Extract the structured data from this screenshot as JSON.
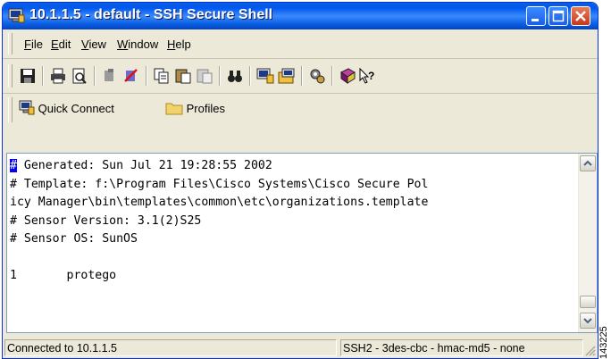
{
  "window": {
    "title": "10.1.1.5 - default - SSH Secure Shell",
    "title_color": "#ffffff",
    "titlebar_color": "#0058ee"
  },
  "menu": {
    "items": [
      {
        "label": "File",
        "u": "F",
        "rest": "ile"
      },
      {
        "label": "Edit",
        "u": "E",
        "rest": "dit"
      },
      {
        "label": "View",
        "u": "V",
        "rest": "iew"
      },
      {
        "label": "Window",
        "u": "W",
        "rest": "indow"
      },
      {
        "label": "Help",
        "u": "H",
        "rest": "elp"
      }
    ]
  },
  "toolbar": {
    "icons": [
      "save-icon",
      "print-icon",
      "print-preview-icon",
      "disconnect-icon",
      "disconnect-red-icon",
      "copy-icon",
      "paste-icon",
      "paste-disabled-icon",
      "find-icon",
      "new-terminal-icon",
      "new-file-transfer-icon",
      "settings-icon",
      "help-book-icon",
      "whats-this-icon"
    ]
  },
  "quickbar": {
    "quick_connect": "Quick Connect",
    "profiles": "Profiles"
  },
  "terminal": {
    "lines": [
      "# Generated: Sun Jul 21 19:28:55 2002",
      "# Template: f:\\Program Files\\Cisco Systems\\Cisco Secure Pol",
      "icy Manager\\bin\\templates\\common\\etc\\organizations.template",
      "# Sensor Version: 3.1(2)S25",
      "# Sensor OS: SunOS",
      "",
      "1       protego"
    ],
    "cursor_char": "#"
  },
  "status": {
    "connection": "Connected to 10.1.1.5",
    "cipher": "SSH2 - 3des-cbc - hmac-md5 - none"
  },
  "figure_code": "143225"
}
